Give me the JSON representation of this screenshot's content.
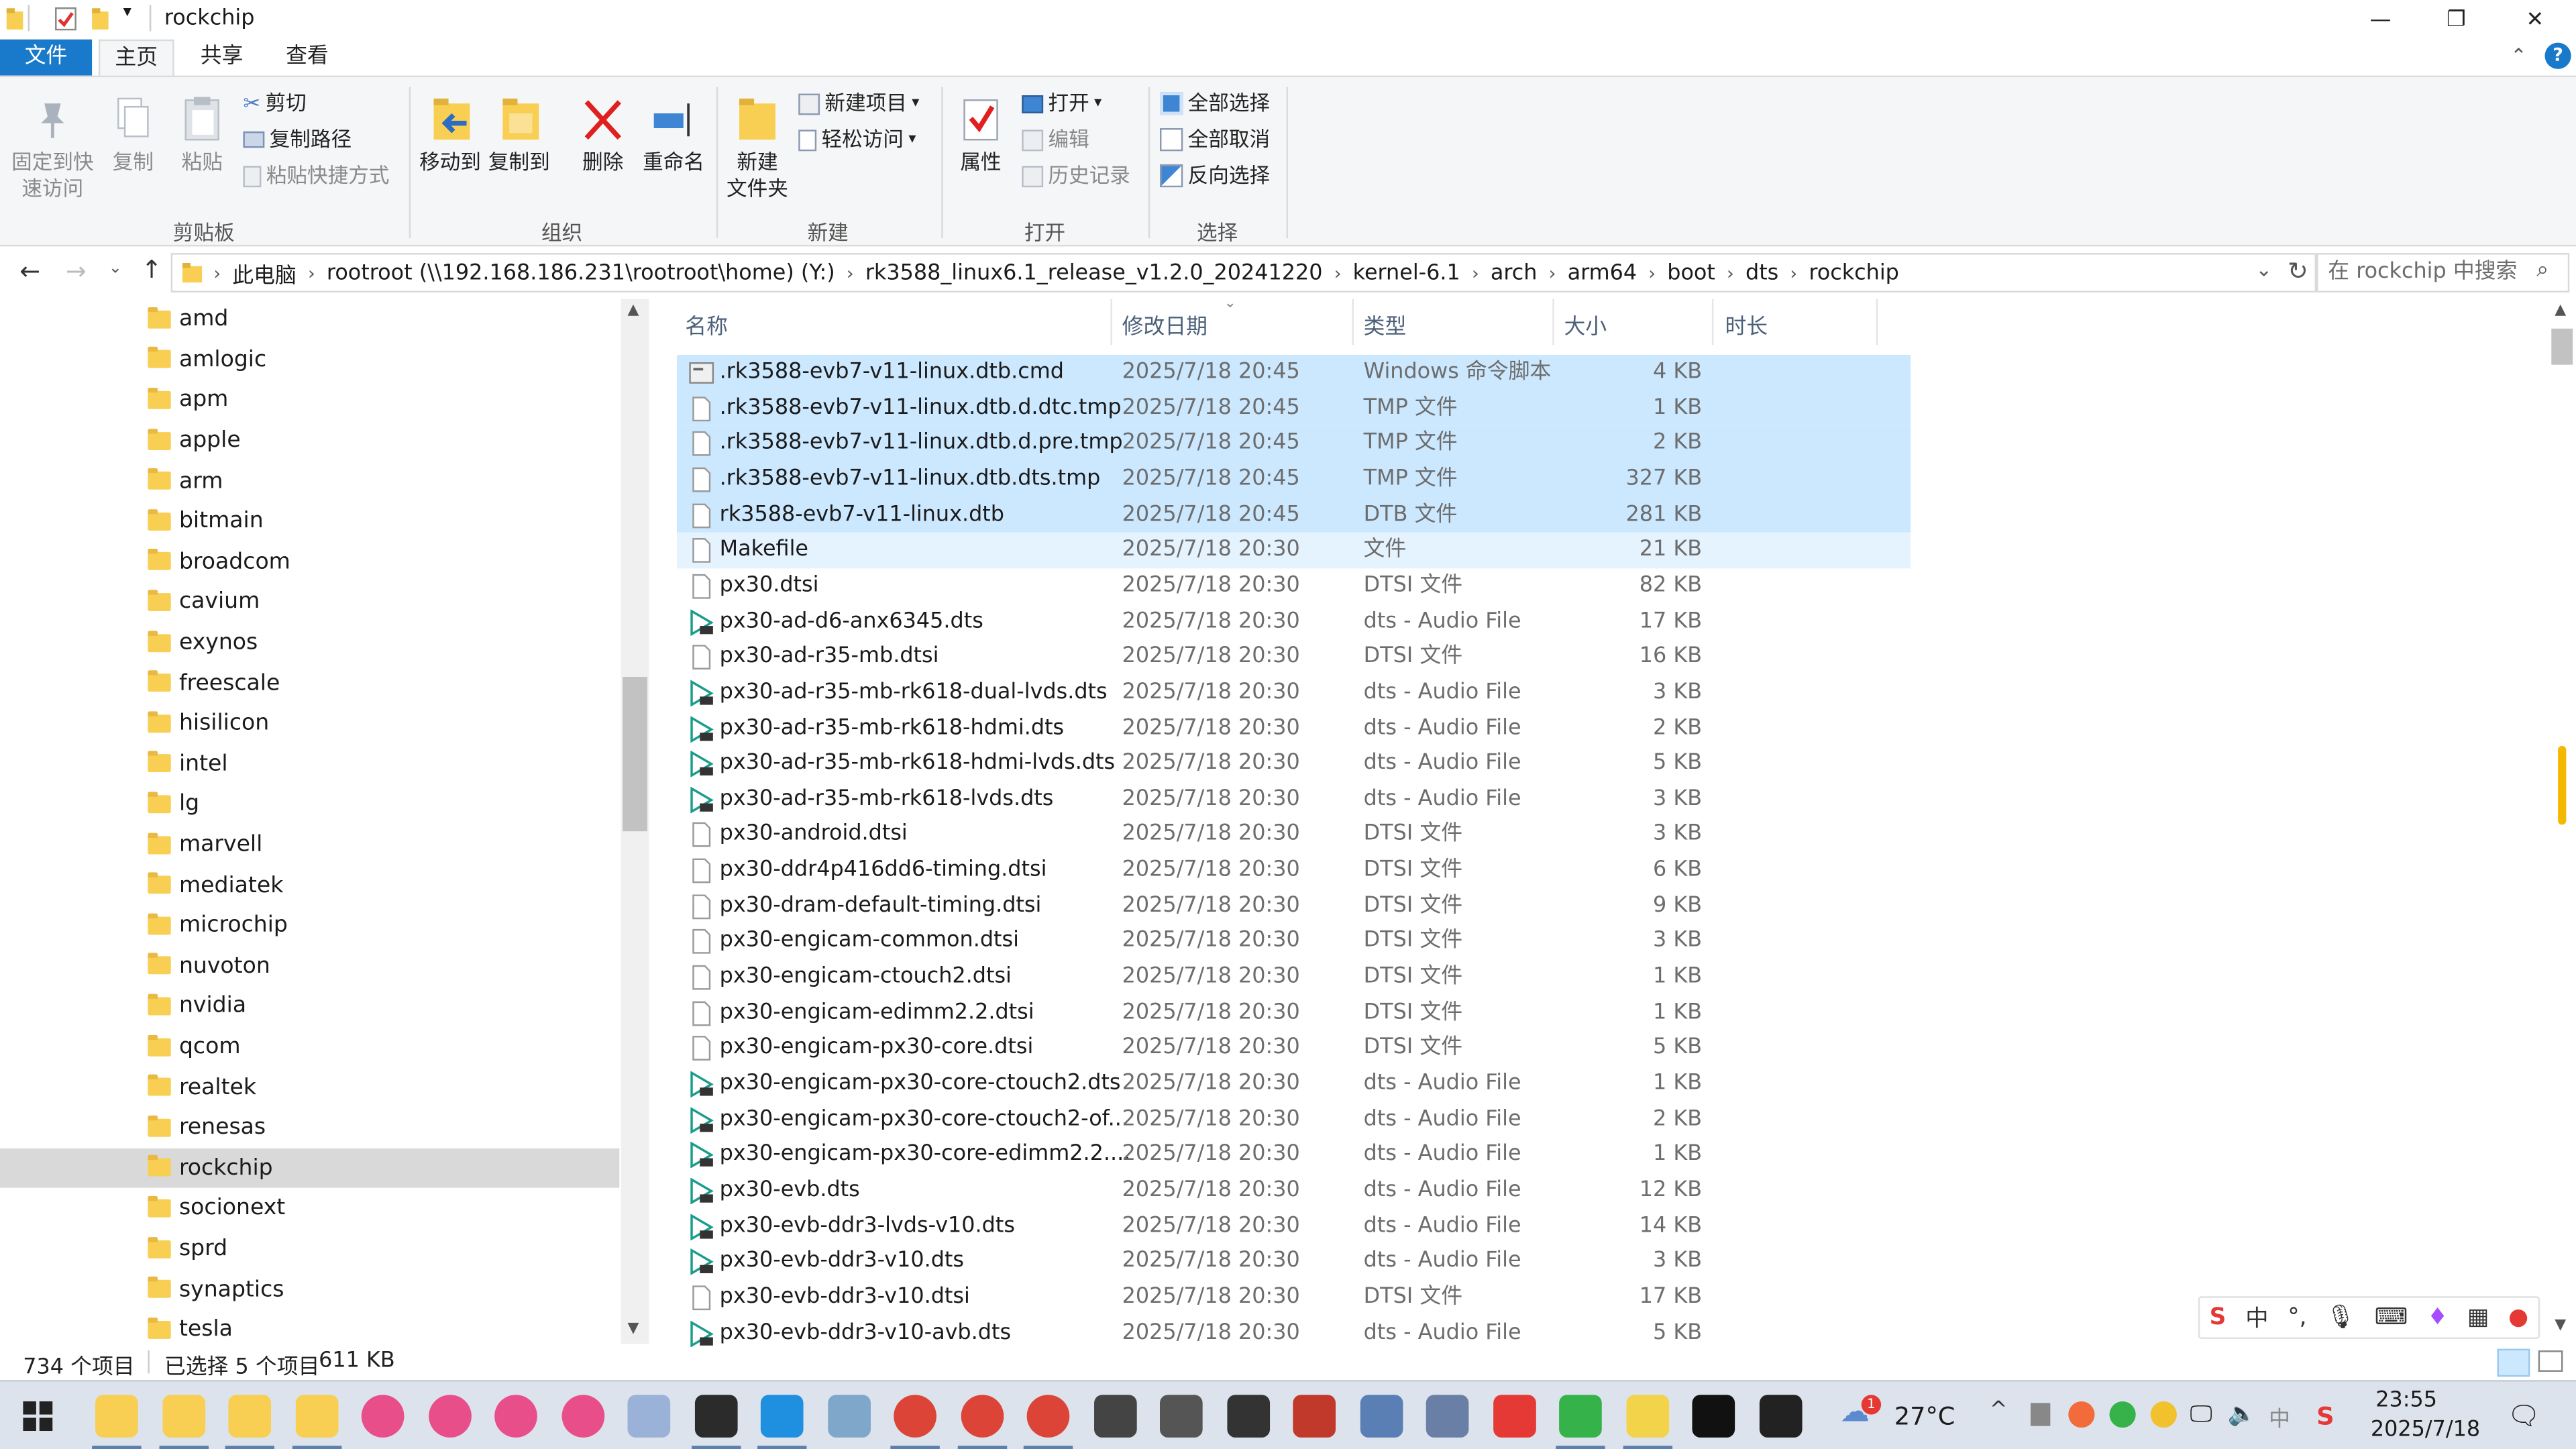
{
  "window": {
    "title": "rockchip",
    "minimize": "—",
    "restore": "❐",
    "close": "✕"
  },
  "tabs": {
    "file": "文件",
    "home": "主页",
    "share": "共享",
    "view": "查看"
  },
  "ribbon": {
    "pin": "固定到快速访问",
    "pin_l1": "固定到快",
    "pin_l2": "速访问",
    "copy": "复制",
    "paste": "粘贴",
    "cut": "剪切",
    "copy_path": "复制路径",
    "paste_shortcut": "粘贴快捷方式",
    "clipboard_group": "剪贴板",
    "move_to": "移动到",
    "copy_to": "复制到",
    "delete": "删除",
    "rename": "重命名",
    "organize_group": "组织",
    "new_folder_l1": "新建",
    "new_folder_l2": "文件夹",
    "new_item": "新建项目",
    "easy_access": "轻松访问",
    "new_group": "新建",
    "properties": "属性",
    "open": "打开",
    "edit": "编辑",
    "history": "历史记录",
    "open_group": "打开",
    "select_all": "全部选择",
    "select_none": "全部取消",
    "invert": "反向选择",
    "select_group": "选择"
  },
  "address": {
    "crumbs": [
      "此电脑",
      "rootroot (\\\\192.168.186.231\\rootroot\\home) (Y:)",
      "rk3588_linux6.1_release_v1.2.0_20241220",
      "kernel-6.1",
      "arch",
      "arm64",
      "boot",
      "dts",
      "rockchip"
    ],
    "search_placeholder": "在 rockchip 中搜索"
  },
  "nav": {
    "items": [
      "amd",
      "amlogic",
      "apm",
      "apple",
      "arm",
      "bitmain",
      "broadcom",
      "cavium",
      "exynos",
      "freescale",
      "hisilicon",
      "intel",
      "lg",
      "marvell",
      "mediatek",
      "microchip",
      "nuvoton",
      "nvidia",
      "qcom",
      "realtek",
      "renesas",
      "rockchip",
      "socionext",
      "sprd",
      "synaptics",
      "tesla"
    ],
    "selected": "rockchip"
  },
  "columns": {
    "name": "名称",
    "date": "修改日期",
    "type": "类型",
    "size": "大小",
    "length": "时长"
  },
  "files": [
    {
      "name": ".rk3588-evb7-v11-linux.dtb.cmd",
      "date": "2025/7/18 20:45",
      "type": "Windows 命令脚本",
      "size": "4 KB",
      "icon": "cmd",
      "sel": true
    },
    {
      "name": ".rk3588-evb7-v11-linux.dtb.d.dtc.tmp",
      "date": "2025/7/18 20:45",
      "type": "TMP 文件",
      "size": "1 KB",
      "icon": "doc",
      "sel": true
    },
    {
      "name": ".rk3588-evb7-v11-linux.dtb.d.pre.tmp",
      "date": "2025/7/18 20:45",
      "type": "TMP 文件",
      "size": "2 KB",
      "icon": "doc",
      "sel": true
    },
    {
      "name": ".rk3588-evb7-v11-linux.dtb.dts.tmp",
      "date": "2025/7/18 20:45",
      "type": "TMP 文件",
      "size": "327 KB",
      "icon": "doc",
      "sel": true
    },
    {
      "name": "rk3588-evb7-v11-linux.dtb",
      "date": "2025/7/18 20:45",
      "type": "DTB 文件",
      "size": "281 KB",
      "icon": "doc",
      "sel": true
    },
    {
      "name": "Makefile",
      "date": "2025/7/18 20:30",
      "type": "文件",
      "size": "21 KB",
      "icon": "doc",
      "sel": false,
      "hover": true
    },
    {
      "name": "px30.dtsi",
      "date": "2025/7/18 20:30",
      "type": "DTSI 文件",
      "size": "82 KB",
      "icon": "doc"
    },
    {
      "name": "px30-ad-d6-anx6345.dts",
      "date": "2025/7/18 20:30",
      "type": "dts - Audio File",
      "size": "17 KB",
      "icon": "media"
    },
    {
      "name": "px30-ad-r35-mb.dtsi",
      "date": "2025/7/18 20:30",
      "type": "DTSI 文件",
      "size": "16 KB",
      "icon": "doc"
    },
    {
      "name": "px30-ad-r35-mb-rk618-dual-lvds.dts",
      "date": "2025/7/18 20:30",
      "type": "dts - Audio File",
      "size": "3 KB",
      "icon": "media"
    },
    {
      "name": "px30-ad-r35-mb-rk618-hdmi.dts",
      "date": "2025/7/18 20:30",
      "type": "dts - Audio File",
      "size": "2 KB",
      "icon": "media"
    },
    {
      "name": "px30-ad-r35-mb-rk618-hdmi-lvds.dts",
      "date": "2025/7/18 20:30",
      "type": "dts - Audio File",
      "size": "5 KB",
      "icon": "media"
    },
    {
      "name": "px30-ad-r35-mb-rk618-lvds.dts",
      "date": "2025/7/18 20:30",
      "type": "dts - Audio File",
      "size": "3 KB",
      "icon": "media"
    },
    {
      "name": "px30-android.dtsi",
      "date": "2025/7/18 20:30",
      "type": "DTSI 文件",
      "size": "3 KB",
      "icon": "doc"
    },
    {
      "name": "px30-ddr4p416dd6-timing.dtsi",
      "date": "2025/7/18 20:30",
      "type": "DTSI 文件",
      "size": "6 KB",
      "icon": "doc"
    },
    {
      "name": "px30-dram-default-timing.dtsi",
      "date": "2025/7/18 20:30",
      "type": "DTSI 文件",
      "size": "9 KB",
      "icon": "doc"
    },
    {
      "name": "px30-engicam-common.dtsi",
      "date": "2025/7/18 20:30",
      "type": "DTSI 文件",
      "size": "3 KB",
      "icon": "doc"
    },
    {
      "name": "px30-engicam-ctouch2.dtsi",
      "date": "2025/7/18 20:30",
      "type": "DTSI 文件",
      "size": "1 KB",
      "icon": "doc"
    },
    {
      "name": "px30-engicam-edimm2.2.dtsi",
      "date": "2025/7/18 20:30",
      "type": "DTSI 文件",
      "size": "1 KB",
      "icon": "doc"
    },
    {
      "name": "px30-engicam-px30-core.dtsi",
      "date": "2025/7/18 20:30",
      "type": "DTSI 文件",
      "size": "5 KB",
      "icon": "doc"
    },
    {
      "name": "px30-engicam-px30-core-ctouch2.dts",
      "date": "2025/7/18 20:30",
      "type": "dts - Audio File",
      "size": "1 KB",
      "icon": "media"
    },
    {
      "name": "px30-engicam-px30-core-ctouch2-of...",
      "date": "2025/7/18 20:30",
      "type": "dts - Audio File",
      "size": "2 KB",
      "icon": "media"
    },
    {
      "name": "px30-engicam-px30-core-edimm2.2....",
      "date": "2025/7/18 20:30",
      "type": "dts - Audio File",
      "size": "1 KB",
      "icon": "media"
    },
    {
      "name": "px30-evb.dts",
      "date": "2025/7/18 20:30",
      "type": "dts - Audio File",
      "size": "12 KB",
      "icon": "media"
    },
    {
      "name": "px30-evb-ddr3-lvds-v10.dts",
      "date": "2025/7/18 20:30",
      "type": "dts - Audio File",
      "size": "14 KB",
      "icon": "media"
    },
    {
      "name": "px30-evb-ddr3-v10.dts",
      "date": "2025/7/18 20:30",
      "type": "dts - Audio File",
      "size": "3 KB",
      "icon": "media"
    },
    {
      "name": "px30-evb-ddr3-v10.dtsi",
      "date": "2025/7/18 20:30",
      "type": "DTSI 文件",
      "size": "17 KB",
      "icon": "doc"
    },
    {
      "name": "px30-evb-ddr3-v10-avb.dts",
      "date": "2025/7/18 20:30",
      "type": "dts - Audio File",
      "size": "5 KB",
      "icon": "media"
    }
  ],
  "status": {
    "count": "734 个项目",
    "selected": "已选择 5 个项目",
    "selected_size": "611 KB"
  },
  "ime": {
    "lang": "中"
  },
  "taskbar": {
    "temp": "27°C",
    "time": "23:55",
    "date": "2025/7/18",
    "weather_badge": "1",
    "tray_lang": "中"
  },
  "colors": {
    "accent": "#1979ca",
    "selection": "#cce8ff",
    "nav_selected": "#d9d9d9"
  }
}
